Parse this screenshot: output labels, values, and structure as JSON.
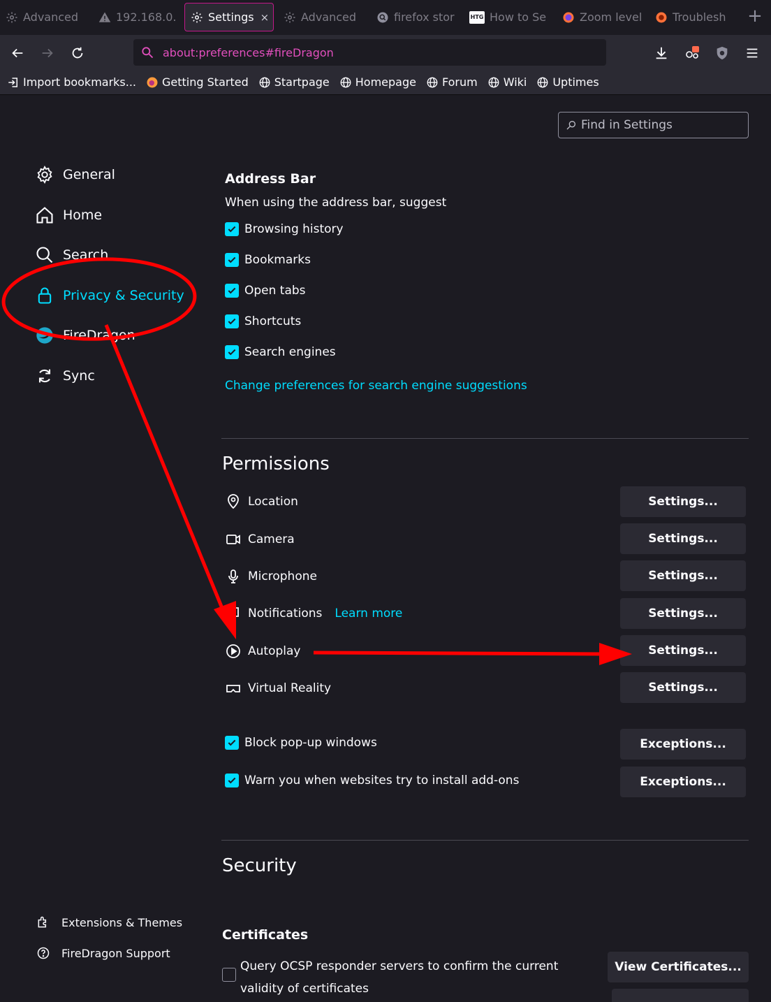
{
  "tabs": [
    {
      "label": "Advanced",
      "icon": "gear-icon"
    },
    {
      "label": "192.168.0.",
      "icon": "warning-icon"
    },
    {
      "label": "Settings",
      "icon": "gear-icon",
      "active": true
    },
    {
      "label": "Advanced",
      "icon": "gear-icon"
    },
    {
      "label": "firefox stor",
      "icon": "search-engine-icon"
    },
    {
      "label": "How to Se",
      "icon": "htg-icon",
      "badge": "HTG"
    },
    {
      "label": "Zoom level",
      "icon": "firefox-icon"
    },
    {
      "label": "Troublesh",
      "icon": "firefox-icon"
    }
  ],
  "tab_close_label": "×",
  "new_tab_label": "+",
  "url": "about:preferences#fireDragon",
  "bookmarks": [
    {
      "label": "Import bookmarks...",
      "icon": "import-icon"
    },
    {
      "label": "Getting Started",
      "icon": "firefox-icon"
    },
    {
      "label": "Startpage",
      "icon": "globe-icon"
    },
    {
      "label": "Homepage",
      "icon": "globe-icon"
    },
    {
      "label": "Forum",
      "icon": "globe-icon"
    },
    {
      "label": "Wiki",
      "icon": "globe-icon"
    },
    {
      "label": "Uptimes",
      "icon": "globe-icon"
    }
  ],
  "find_placeholder": "Find in Settings",
  "categories": [
    {
      "label": "General",
      "icon": "gear-icon"
    },
    {
      "label": "Home",
      "icon": "home-icon"
    },
    {
      "label": "Search",
      "icon": "search-icon"
    },
    {
      "label": "Privacy & Security",
      "icon": "lock-icon",
      "selected": true
    },
    {
      "label": "FireDragon",
      "icon": "firedragon-icon"
    },
    {
      "label": "Sync",
      "icon": "sync-icon"
    }
  ],
  "footer_links": [
    {
      "label": "Extensions & Themes",
      "icon": "puzzle-icon"
    },
    {
      "label": "FireDragon Support",
      "icon": "help-icon"
    }
  ],
  "address_bar": {
    "heading": "Address Bar",
    "intro": "When using the address bar, suggest",
    "options": [
      {
        "label": "Browsing history",
        "checked": true
      },
      {
        "label": "Bookmarks",
        "checked": true
      },
      {
        "label": "Open tabs",
        "checked": true
      },
      {
        "label": "Shortcuts",
        "checked": true
      },
      {
        "label": "Search engines",
        "checked": true
      }
    ],
    "link": "Change preferences for search engine suggestions"
  },
  "permissions": {
    "heading": "Permissions",
    "items": [
      {
        "label": "Location",
        "icon": "location-icon",
        "button": "Settings..."
      },
      {
        "label": "Camera",
        "icon": "camera-icon",
        "button": "Settings..."
      },
      {
        "label": "Microphone",
        "icon": "microphone-icon",
        "button": "Settings..."
      },
      {
        "label": "Notifications",
        "icon": "notification-icon",
        "button": "Settings...",
        "link": "Learn more"
      },
      {
        "label": "Autoplay",
        "icon": "autoplay-icon",
        "button": "Settings..."
      },
      {
        "label": "Virtual Reality",
        "icon": "vr-icon",
        "button": "Settings..."
      }
    ],
    "options": [
      {
        "label": "Block pop-up windows",
        "checked": true,
        "button": "Exceptions..."
      },
      {
        "label": "Warn you when websites try to install add-ons",
        "checked": true,
        "button": "Exceptions..."
      }
    ]
  },
  "security": {
    "heading": "Security",
    "certificates_heading": "Certificates",
    "ocsp_label": "Query OCSP responder servers to confirm the current validity of certificates",
    "ocsp_checked": false,
    "view_button": "View Certificates..."
  },
  "colors": {
    "accent": "#00ddff",
    "annotation": "#ff0000",
    "url_text": "#e24fbd",
    "background": "#1c1b22",
    "toolbar": "#2b2a33"
  }
}
